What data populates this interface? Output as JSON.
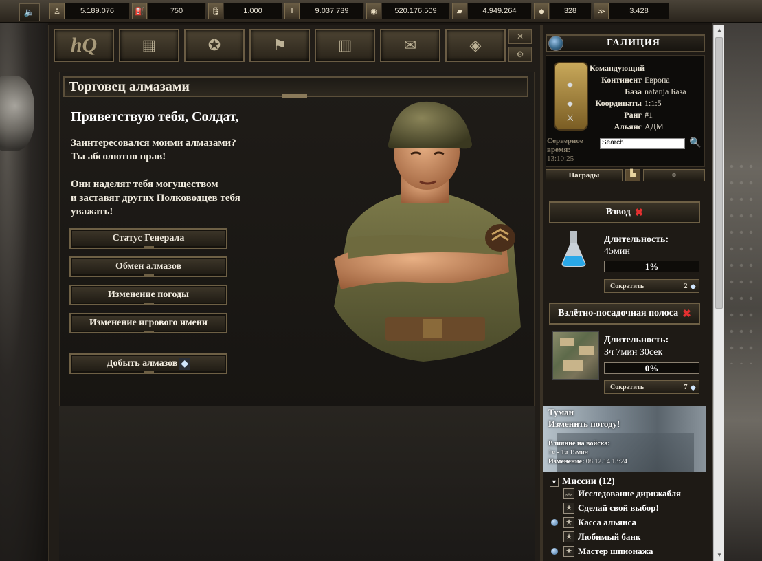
{
  "resources": [
    {
      "icon": "soldier-icon",
      "glyph": "♙",
      "value": "5.189.076",
      "width": 95
    },
    {
      "icon": "fuel-icon",
      "glyph": "⛽",
      "value": "750",
      "width": 86
    },
    {
      "icon": "oil-icon",
      "glyph": "🛢",
      "value": "1.000",
      "width": 86
    },
    {
      "icon": "ammo-icon",
      "glyph": "‖",
      "value": "9.037.739",
      "width": 94
    },
    {
      "icon": "coin-icon",
      "glyph": "◉",
      "value": "520.176.509",
      "width": 100
    },
    {
      "icon": "gold-icon",
      "glyph": "▰",
      "value": "4.949.264",
      "width": 94
    },
    {
      "icon": "diamond-icon",
      "glyph": "◆",
      "value": "328",
      "width": 62
    },
    {
      "icon": "rank-icon",
      "glyph": "≫",
      "value": "3.428",
      "width": 88
    }
  ],
  "nav": [
    "hQ",
    "▦",
    "✪",
    "⚑",
    "▥",
    "✉",
    "◈"
  ],
  "page": {
    "title": "Торговец алмазами",
    "greeting": "Приветствую тебя, Солдат,",
    "para1_line1": "Заинтересовался моими алмазами?",
    "para1_line2": "Ты абсолютно прав!",
    "para2_line1": "Они наделят тебя могуществом",
    "para2_line2": "и заставят других Полководцев тебя",
    "para2_line3": "уважать!",
    "buttons": {
      "general_status": "Статус Генерала",
      "diamond_exchange": "Обмен алмазов",
      "weather_change": "Изменение погоды",
      "name_change": "Изменение игрового имени",
      "get_diamonds": "Добыть алмазов"
    }
  },
  "sidebar": {
    "city": "ГАЛИЦИЯ",
    "commander_label": "Командующий",
    "continent_label": "Континент",
    "continent": "Европа",
    "base_label": "База",
    "base": "nafanja База",
    "coords_label": "Координаты",
    "coords": "1:1:5",
    "rank_label": "Ранг",
    "rank": "#1",
    "alliance_label": "Альянс",
    "alliance": "АДМ",
    "server_time_label1": "Серверное",
    "server_time_label2": "время:",
    "server_time": "13:10:25",
    "search_placeholder": "Search",
    "awards_label": "Награды",
    "awards_count": "0"
  },
  "tasks": {
    "platoon": {
      "title": "Взвод",
      "duration_label": "Длительность:",
      "duration": "45мин",
      "progress_text": "1%",
      "progress_fraction": 0.01,
      "shorten_label": "Сократить",
      "shorten_cost": "2"
    },
    "runway": {
      "title": "Взлётно-посадочная полоса",
      "duration_label": "Длительность:",
      "duration": "3ч 7мин 30сек",
      "progress_text": "0%",
      "progress_fraction": 0.0,
      "shorten_label": "Сократить",
      "shorten_cost": "7"
    }
  },
  "weather": {
    "name": "Туман",
    "action": "Изменить погоду!",
    "impact_label": "Влияние на войска:",
    "impact_value": "1ч - 1ч 15мин",
    "change_label": "Изменение:",
    "change_value": "08.12.14 13:24"
  },
  "missions": {
    "title": "Миссии (12)",
    "items": [
      {
        "label": "Исследование дирижабля",
        "dot": false,
        "icon": "rank-chevron-icon"
      },
      {
        "label": "Сделай свой выбор!",
        "dot": false,
        "icon": "star-icon"
      },
      {
        "label": "Касса альянса",
        "dot": true,
        "icon": "star-icon"
      },
      {
        "label": "Любимый банк",
        "dot": false,
        "icon": "star-icon"
      },
      {
        "label": "Мастер шпионажа",
        "dot": true,
        "icon": "star-icon"
      }
    ]
  },
  "colors": {
    "accent_gold": "#6e6045",
    "progress_red": "#c0302a",
    "close_red": "#e43030"
  }
}
